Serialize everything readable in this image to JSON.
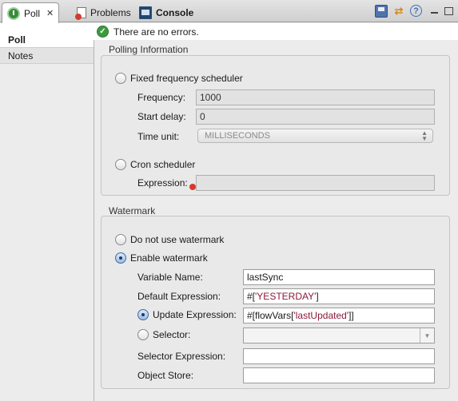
{
  "tabs": [
    {
      "label": "Poll",
      "close": "✕",
      "active": true
    },
    {
      "label": "Problems",
      "active": false
    },
    {
      "label": "Console",
      "active": false
    }
  ],
  "toolbar": {
    "save_icon": "save-icon",
    "sync_icon": "sync-icon",
    "help_glyph": "?"
  },
  "status": {
    "message": "There are no errors.",
    "ok_glyph": "✓"
  },
  "sidebar": {
    "items": [
      {
        "label": "Poll"
      },
      {
        "label": "Notes"
      }
    ]
  },
  "polling": {
    "title": "Polling Information",
    "fixed": {
      "label": "Fixed frequency scheduler",
      "frequency_label": "Frequency:",
      "frequency_value": "1000",
      "start_delay_label": "Start delay:",
      "start_delay_value": "0",
      "time_unit_label": "Time unit:",
      "time_unit_value": "MILLISECONDS"
    },
    "cron": {
      "label": "Cron scheduler",
      "expression_label": "Expression:",
      "expression_value": ""
    }
  },
  "watermark": {
    "title": "Watermark",
    "no_watermark_label": "Do not use watermark",
    "enable_label": "Enable watermark",
    "variable_name_label": "Variable Name:",
    "variable_name_value": "lastSync",
    "default_expression_label": "Default Expression:",
    "default_expression_prefix": "#[",
    "default_expression_string": "'YESTERDAY'",
    "default_expression_suffix": "]",
    "update_expression_label": "Update Expression:",
    "update_expression_prefix": "#[flowVars[",
    "update_expression_string": "'lastUpdated'",
    "update_expression_suffix": "]]",
    "selector_label": "Selector:",
    "selector_value": "",
    "selector_expression_label": "Selector Expression:",
    "selector_expression_value": "",
    "object_store_label": "Object Store:",
    "object_store_value": ""
  }
}
